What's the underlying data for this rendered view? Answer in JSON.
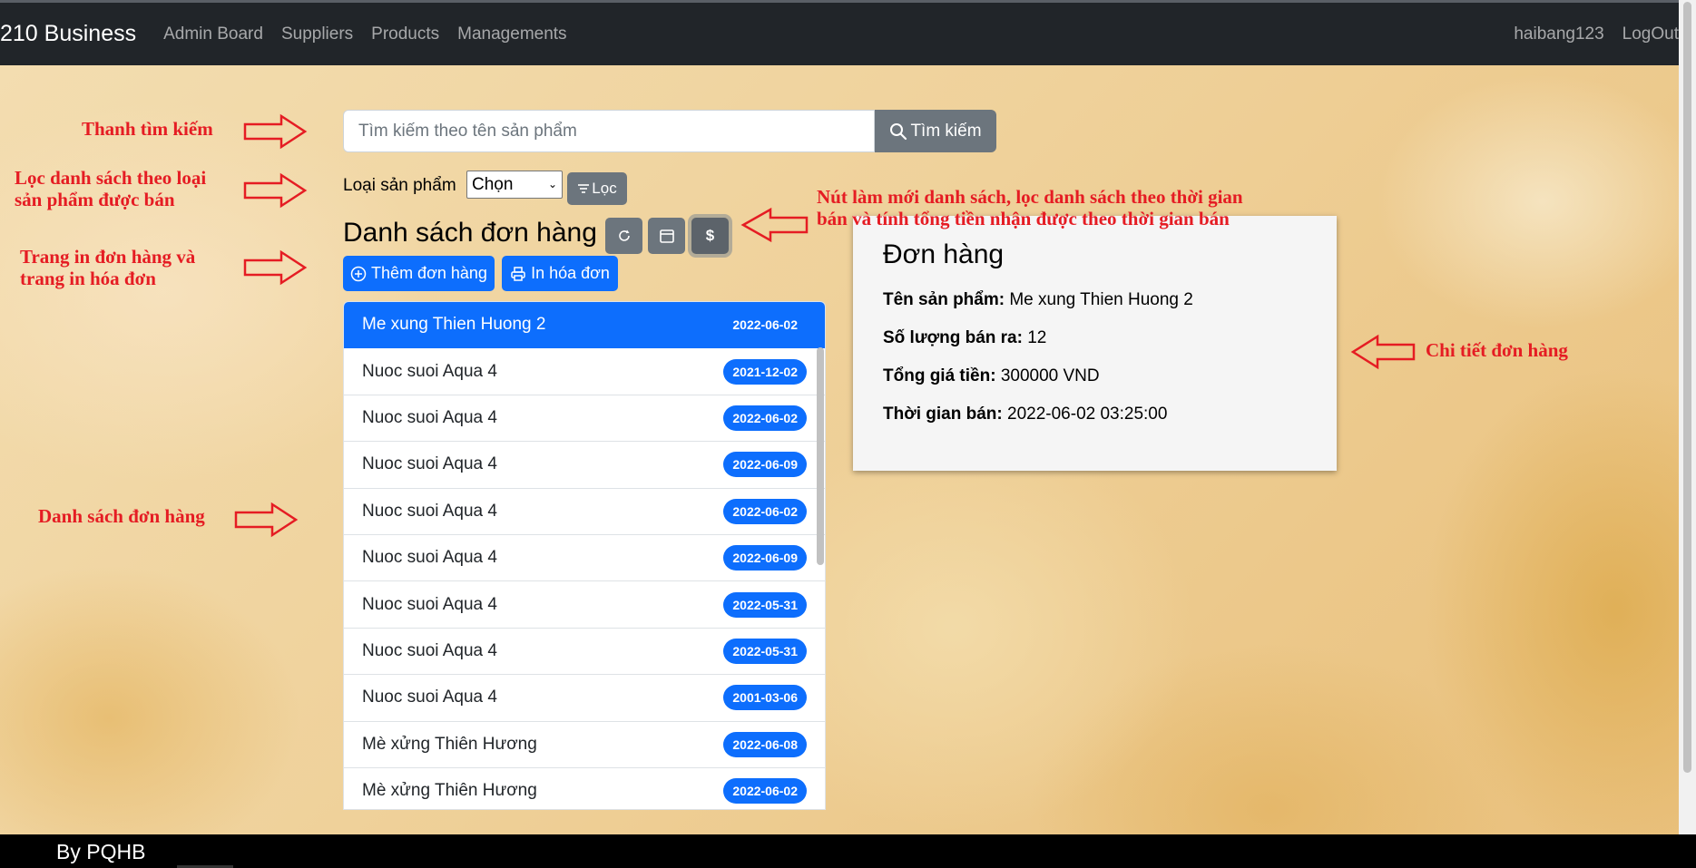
{
  "navbar": {
    "brand": "210 Business",
    "links": [
      "Admin Board",
      "Suppliers",
      "Products",
      "Managements"
    ],
    "user": "haibang123",
    "logout": "LogOut"
  },
  "search": {
    "placeholder": "Tìm kiếm theo tên sản phẩm",
    "button_label": "Tìm kiếm"
  },
  "filter": {
    "label": "Loại sản phẩm",
    "selected": "Chọn",
    "button_label": "Lọc"
  },
  "list": {
    "title": "Danh sách đơn hàng",
    "add_label": "Thêm đơn hàng",
    "print_label": "In hóa đơn",
    "items": [
      {
        "name": "Me xung Thien Huong 2",
        "date": "2022-06-02"
      },
      {
        "name": "Nuoc suoi Aqua 4",
        "date": "2021-12-02"
      },
      {
        "name": "Nuoc suoi Aqua 4",
        "date": "2022-06-02"
      },
      {
        "name": "Nuoc suoi Aqua 4",
        "date": "2022-06-09"
      },
      {
        "name": "Nuoc suoi Aqua 4",
        "date": "2022-06-02"
      },
      {
        "name": "Nuoc suoi Aqua 4",
        "date": "2022-06-09"
      },
      {
        "name": "Nuoc suoi Aqua 4",
        "date": "2022-05-31"
      },
      {
        "name": "Nuoc suoi Aqua 4",
        "date": "2022-05-31"
      },
      {
        "name": "Nuoc suoi Aqua 4",
        "date": "2001-03-06"
      },
      {
        "name": "Mè xửng Thiên Hương",
        "date": "2022-06-08"
      },
      {
        "name": "Mè xửng Thiên Hương",
        "date": "2022-06-02"
      }
    ]
  },
  "detail": {
    "title": "Đơn hàng",
    "product_label": "Tên sản phẩm:",
    "product_value": "Me xung Thien Huong 2",
    "qty_label": "Số lượng bán ra:",
    "qty_value": "12",
    "total_label": "Tổng giá tiền:",
    "total_value": "300000 VND",
    "time_label": "Thời gian bán:",
    "time_value": "2022-06-02 03:25:00"
  },
  "annotations": {
    "search": "Thanh tìm kiếm",
    "filter_1": "Lọc danh sách theo loại",
    "filter_2": "sản phẩm được bán",
    "buttons_1": "Nút làm mới danh sách, lọc danh sách theo thời gian",
    "buttons_2": "bán và tính tổng tiền nhận được theo thời gian bán",
    "print_1": "Trang in đơn hàng và",
    "print_2": "trang in hóa đơn",
    "list": "Danh sách đơn hàng",
    "detail": "Chi tiết đơn hàng"
  },
  "footer": {
    "text": "By PQHB"
  },
  "colors": {
    "primary": "#0d6efd",
    "secondary": "#6c757d",
    "navbar": "#212529",
    "annotation": "#e51c23"
  }
}
